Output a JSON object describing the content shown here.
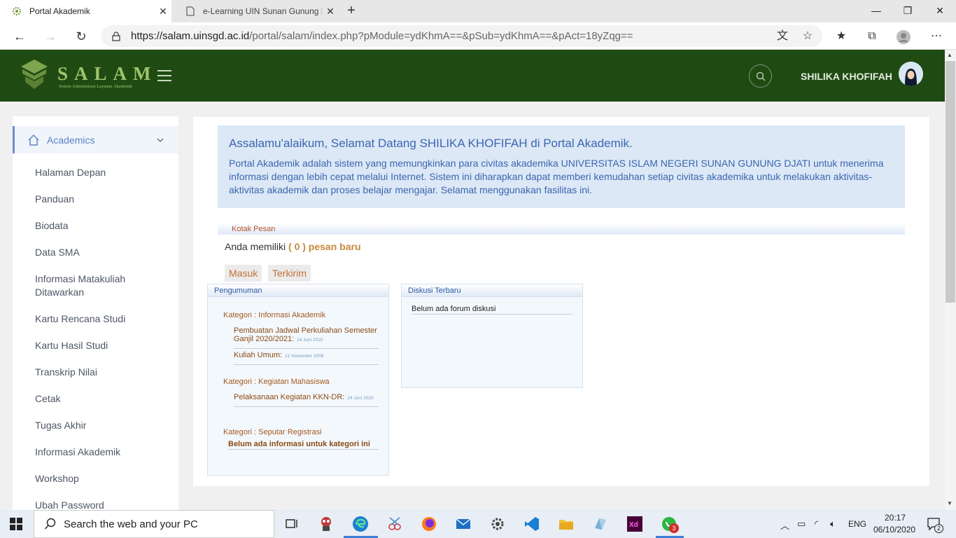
{
  "browser": {
    "tabs": [
      {
        "title": "Portal Akademik",
        "active": true,
        "icon": "salam-favicon"
      },
      {
        "title": "e-Learning UIN Sunan Gunung D",
        "active": false,
        "icon": "page-icon"
      }
    ],
    "url_host": "https://salam.uinsgd.ac.id",
    "url_path": "/portal/salam/index.php?pModule=ydKhmA==&pSub=ydKhmA==&pAct=18yZqg=="
  },
  "header": {
    "logo_text": "SALAM",
    "logo_sub": "Sistem Administrasi Layanan Akademik",
    "user_name": "SHILIKA KHOFIFAH",
    "brand_color": "#1f4b13"
  },
  "sidebar": {
    "section": "Academics",
    "items": [
      {
        "label": "Halaman Depan"
      },
      {
        "label": "Panduan"
      },
      {
        "label": "Biodata"
      },
      {
        "label": "Data SMA"
      },
      {
        "label": "Informasi Matakuliah Ditawarkan"
      },
      {
        "label": "Kartu Rencana Studi"
      },
      {
        "label": "Kartu Hasil Studi"
      },
      {
        "label": "Transkrip Nilai"
      },
      {
        "label": "Cetak"
      },
      {
        "label": "Tugas Akhir"
      },
      {
        "label": "Informasi Akademik"
      },
      {
        "label": "Workshop"
      },
      {
        "label": "Ubah Password"
      }
    ]
  },
  "welcome": {
    "title": "Assalamu'alaikum, Selamat Datang SHILIKA KHOFIFAH di Portal Akademik.",
    "text": "Portal Akademik adalah sistem yang memungkinkan para civitas akademika UNIVERSITAS ISLAM NEGERI SUNAN GUNUNG DJATI untuk menerima informasi dengan lebih cepat melalui Internet. Sistem ini diharapkan dapat memberi kemudahan setiap civitas akademika untuk melakukan aktivitas-aktivitas akademik dan proses belajar mengajar. Selamat menggunakan fasilitas ini."
  },
  "inbox": {
    "title": "Kotak Pesan",
    "message_prefix": "Anda memiliki",
    "message_count": "( 0 ) pesan baru",
    "tab_masuk": "Masuk",
    "tab_terkirim": "Terkirim"
  },
  "pengumuman": {
    "title": "Pengumuman",
    "categories": [
      {
        "name": "Kategori : Informasi Akademik",
        "items": [
          {
            "title": "Pembuatan Jadwal Perkuliahan Semester Ganjil 2020/2021:",
            "date": "24 Juni 2020"
          },
          {
            "title": "Kuliah Umum:",
            "date": "21 November 2008"
          }
        ]
      },
      {
        "name": "Kategori : Kegiatan Mahasiswa",
        "items": [
          {
            "title": "Pelaksanaan Kegiatan KKN-DR:",
            "date": "24 Juni 2020"
          }
        ]
      },
      {
        "name": "Kategori : Seputar Registrasi",
        "empty": "Belum ada informasi untuk kategori ini"
      }
    ]
  },
  "diskusi": {
    "title": "Diskusi Terbaru",
    "empty": "Belum ada forum diskusi"
  },
  "taskbar": {
    "search_placeholder": "Search the web and your PC",
    "language": "ENG",
    "time": "20:17",
    "date": "06/10/2020",
    "notif_count": "2",
    "whatsapp_badge": "3"
  }
}
